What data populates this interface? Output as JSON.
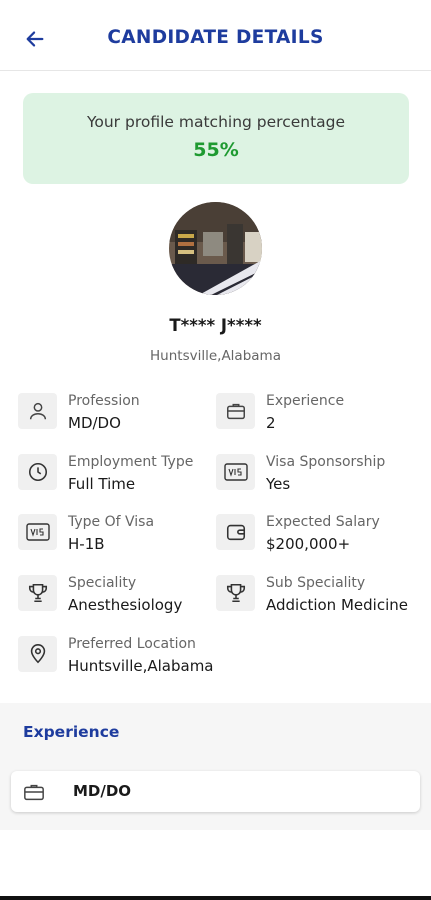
{
  "header": {
    "title": "CANDIDATE DETAILS",
    "back_icon": "arrow-left-icon"
  },
  "match": {
    "label": "Your profile matching percentage",
    "value": "55%",
    "percent": 55
  },
  "candidate": {
    "name": "T**** J****",
    "location": "Huntsville,Alabama"
  },
  "fields": [
    {
      "label": "Profession",
      "value": "MD/DO",
      "icon": "person-icon"
    },
    {
      "label": "Experience",
      "value": "2",
      "icon": "briefcase-icon"
    },
    {
      "label": "Employment Type",
      "value": "Full Time",
      "icon": "clock-icon"
    },
    {
      "label": "Visa Sponsorship",
      "value": "Yes",
      "icon": "visa-card-icon"
    },
    {
      "label": "Type Of Visa",
      "value": "H-1B",
      "icon": "visa-card-icon"
    },
    {
      "label": "Expected Salary",
      "value": "$200,000+",
      "icon": "wallet-icon"
    },
    {
      "label": "Speciality",
      "value": "Anesthesiology",
      "icon": "trophy-icon"
    },
    {
      "label": "Sub Speciality",
      "value": "Addiction Medicine",
      "icon": "trophy-icon"
    },
    {
      "label": "Preferred Location",
      "value": "Huntsville,Alabama",
      "icon": "location-pin-icon"
    }
  ],
  "experience_section": {
    "title": "Experience",
    "items": [
      {
        "label": "MD/DO",
        "icon": "briefcase-icon"
      }
    ]
  },
  "colors": {
    "accent": "#1e3c9e",
    "match_bg": "#ddf3e3",
    "match_value": "#1e9a31"
  }
}
